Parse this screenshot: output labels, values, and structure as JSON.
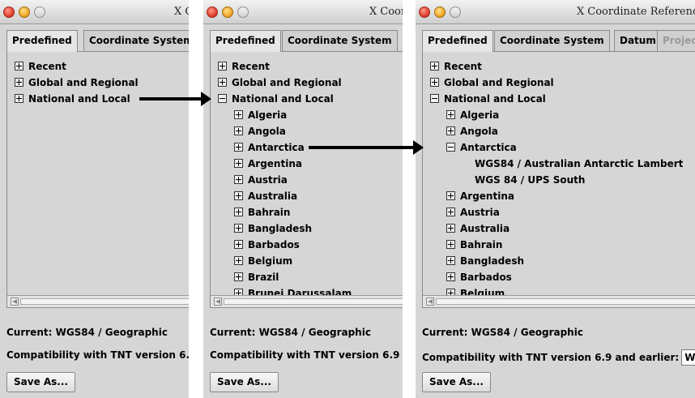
{
  "window": {
    "title": "Coordinate Reference System",
    "title_icon": "X"
  },
  "tabs": [
    "Predefined",
    "Coordinate System",
    "Datum",
    "Projection"
  ],
  "tree": {
    "recent": "Recent",
    "global": "Global and Regional",
    "national": "National and Local",
    "countries": [
      "Algeria",
      "Angola",
      "Antarctica",
      "Argentina",
      "Austria",
      "Australia",
      "Bahrain",
      "Bangladesh",
      "Barbados",
      "Belgium",
      "Brazil",
      "Brunei Darussalam"
    ],
    "antarctica_children": [
      "WGS84 / Australian Antarctic Lambert",
      "WGS 84 / UPS South"
    ]
  },
  "status": {
    "current": "Current: WGS84 / Geographic",
    "compatibility": "Compatibility with TNT version 6.9 and earlier:",
    "compat_value": "W"
  },
  "buttons": {
    "save_as": "Save As..."
  },
  "icons": {
    "close": "close-icon",
    "minimize": "minimize-icon",
    "zoom": "zoom-icon",
    "expand": "plus-toggle-icon",
    "collapse": "minus-toggle-icon",
    "scroll_left": "scroll-left-arrow-icon",
    "x11": "x11-icon"
  },
  "colors": {
    "panel_bg": "#d6d6d6",
    "close": "#e0412f",
    "minimize": "#f0a92b",
    "arrow": "#000000"
  }
}
